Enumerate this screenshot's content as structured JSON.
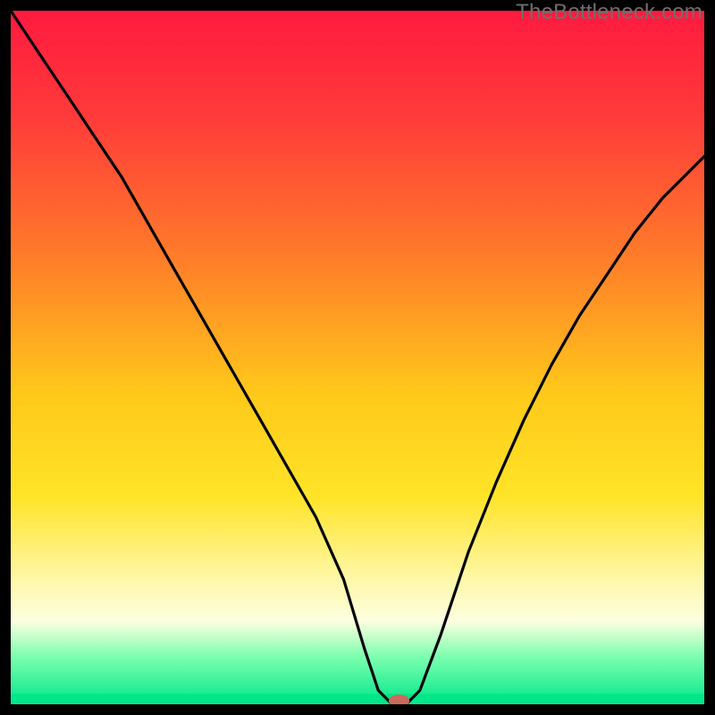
{
  "watermark": "TheBottleneck.com",
  "chart_data": {
    "type": "line",
    "title": "",
    "xlabel": "",
    "ylabel": "",
    "xlim": [
      0,
      100
    ],
    "ylim": [
      0,
      100
    ],
    "background_gradient": {
      "stops": [
        {
          "pct": 0,
          "color": "#ff1a3f"
        },
        {
          "pct": 15,
          "color": "#ff3a3a"
        },
        {
          "pct": 35,
          "color": "#ff7a2a"
        },
        {
          "pct": 55,
          "color": "#ffc81a"
        },
        {
          "pct": 70,
          "color": "#ffe427"
        },
        {
          "pct": 82,
          "color": "#fff7a8"
        },
        {
          "pct": 88,
          "color": "#fdffe0"
        },
        {
          "pct": 93,
          "color": "#7fffb0"
        },
        {
          "pct": 100,
          "color": "#00e78a"
        }
      ]
    },
    "curve": {
      "x": [
        0,
        4,
        8,
        12,
        16,
        20,
        24,
        28,
        32,
        36,
        40,
        44,
        48,
        51,
        53,
        55,
        57,
        59,
        62,
        66,
        70,
        74,
        78,
        82,
        86,
        90,
        94,
        98,
        100
      ],
      "y": [
        100,
        94,
        88,
        82,
        76,
        69,
        62,
        55,
        48,
        41,
        34,
        27,
        18,
        8,
        2,
        0,
        0,
        2,
        10,
        22,
        32,
        41,
        49,
        56,
        62,
        68,
        73,
        77,
        79
      ]
    },
    "floor_band": {
      "y_from": 0,
      "y_to": 1.5,
      "color": "#00e78a"
    },
    "marker": {
      "x": 56,
      "y": 0.5,
      "color": "#c96a5c",
      "rx": 1.5,
      "ry": 0.9
    }
  }
}
